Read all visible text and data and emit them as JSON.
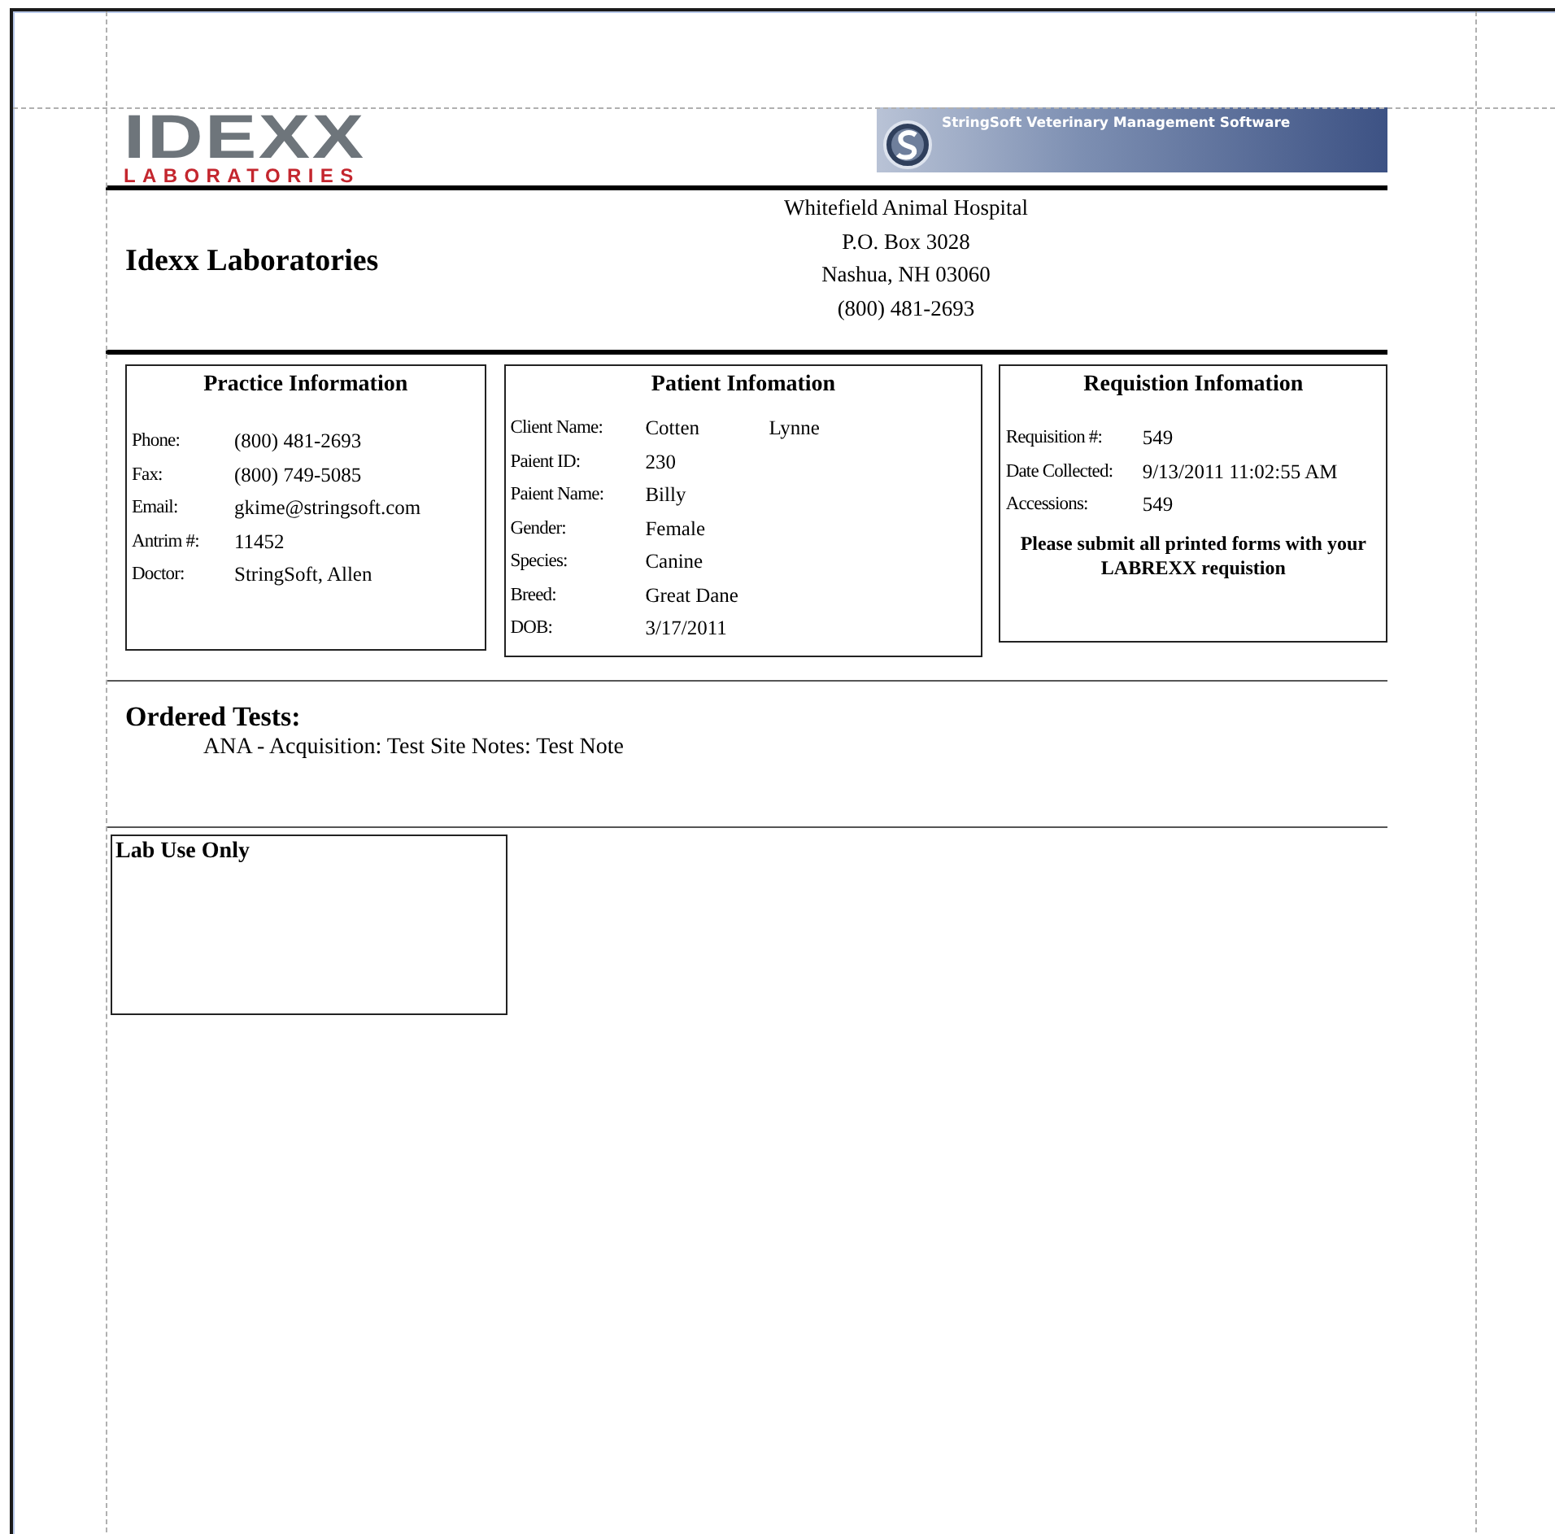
{
  "header": {
    "logo": {
      "wordmark": "IDEXX",
      "subtitle": "LABORATORIES"
    },
    "banner": {
      "text": "StringSoft Veterinary Management Software"
    },
    "lab_name": "Idexx Laboratories",
    "hospital_address": [
      "Whitefield Animal Hospital",
      "P.O. Box 3028",
      "Nashua, NH 03060",
      "(800) 481-2693"
    ]
  },
  "panels": [
    {
      "title": "Practice Information",
      "rows": [
        {
          "label": "Phone:",
          "values": [
            "(800) 481-2693"
          ]
        },
        {
          "label": "Fax:",
          "values": [
            "(800) 749-5085"
          ]
        },
        {
          "label": "Email:",
          "values": [
            "gkime@stringsoft.com"
          ]
        },
        {
          "label": "Antrim #:",
          "values": [
            "11452"
          ]
        },
        {
          "label": "Doctor:",
          "values": [
            "StringSoft, Allen"
          ]
        }
      ]
    },
    {
      "title": "Patient Infomation",
      "rows": [
        {
          "label": "Client Name:",
          "values": [
            "Cotten",
            "Lynne"
          ]
        },
        {
          "label": "Paient ID:",
          "values": [
            "230"
          ]
        },
        {
          "label": "Paient Name:",
          "values": [
            "Billy"
          ]
        },
        {
          "label": "Gender:",
          "values": [
            "Female"
          ]
        },
        {
          "label": "Species:",
          "values": [
            "Canine"
          ]
        },
        {
          "label": "Breed:",
          "values": [
            "Great Dane"
          ]
        },
        {
          "label": "DOB:",
          "values": [
            "3/17/2011"
          ]
        }
      ]
    },
    {
      "title": "Requistion Infomation",
      "rows": [
        {
          "label": "Requisition #:",
          "values": [
            "549"
          ]
        },
        {
          "label": "Date Collected:",
          "values": [
            "9/13/2011 11:02:55 AM"
          ]
        },
        {
          "label": "Accessions:",
          "values": [
            "549"
          ]
        }
      ],
      "note": "Please submit all printed forms with your LABREXX requistion"
    }
  ],
  "ordered_tests": {
    "title": "Ordered Tests:",
    "items": [
      "ANA - Acquisition: Test Site Notes: Test Note"
    ]
  },
  "lab_use": {
    "title": "Lab Use Only"
  }
}
